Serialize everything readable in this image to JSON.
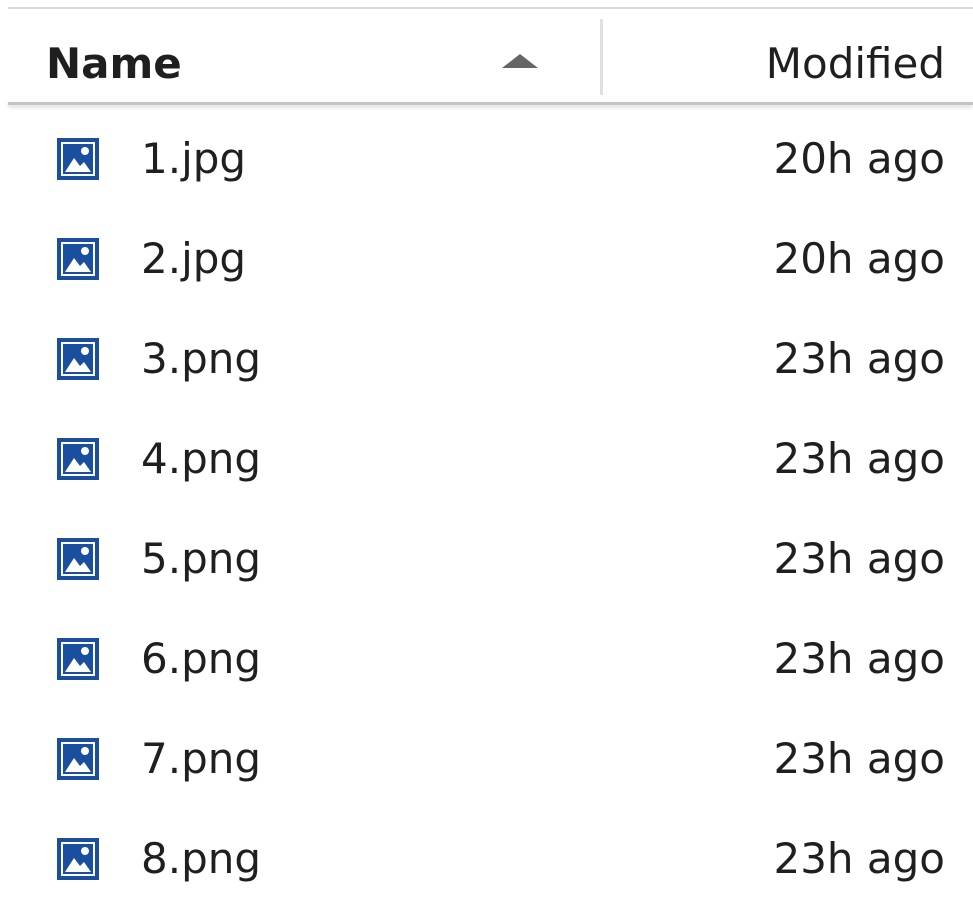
{
  "header": {
    "name_label": "Name",
    "modified_label": "Modified",
    "sort_icon": "caret-up-icon"
  },
  "colors": {
    "icon_blue": "#1a4fa0",
    "text": "#1f1f1f",
    "sort_arrow": "#666666"
  },
  "files": [
    {
      "name": "1.jpg",
      "modified": "20h ago",
      "icon": "image-file-icon"
    },
    {
      "name": "2.jpg",
      "modified": "20h ago",
      "icon": "image-file-icon"
    },
    {
      "name": "3.png",
      "modified": "23h ago",
      "icon": "image-file-icon"
    },
    {
      "name": "4.png",
      "modified": "23h ago",
      "icon": "image-file-icon"
    },
    {
      "name": "5.png",
      "modified": "23h ago",
      "icon": "image-file-icon"
    },
    {
      "name": "6.png",
      "modified": "23h ago",
      "icon": "image-file-icon"
    },
    {
      "name": "7.png",
      "modified": "23h ago",
      "icon": "image-file-icon"
    },
    {
      "name": "8.png",
      "modified": "23h ago",
      "icon": "image-file-icon"
    }
  ]
}
